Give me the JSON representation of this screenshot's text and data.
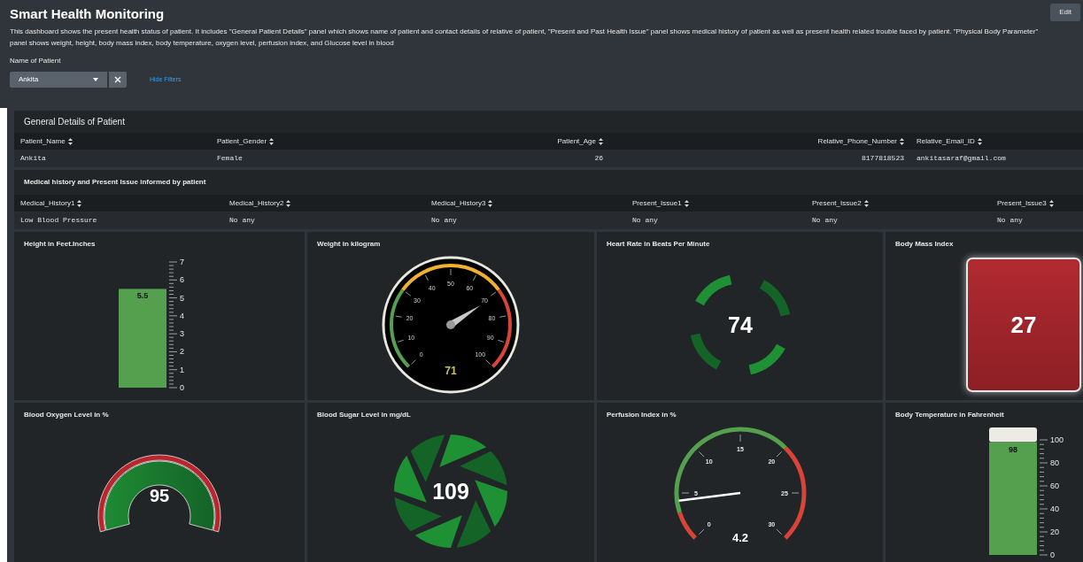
{
  "dashboard": {
    "title": "Smart Health Monitoring",
    "description": "This dashboard shows the present health status of patient. It includes \"General Patient Details\" panel which shows name of patient and contact details of relative of patient, \"Present and Past Health Issue\" panel shows medical history of patient as well as present health related trouble faced by patient. \"Physical Body Parameter\" panel shows weight, height, body mass index, body temperature, oxygen level, perfusion index, and Glucose level in blood",
    "edit_button": "Edit"
  },
  "filter": {
    "label": "Name of Patient",
    "value": "Ankita",
    "hide_filters": "Hide Filters"
  },
  "patient_table": {
    "title": "General Details of Patient",
    "columns": [
      "Patient_Name",
      "Patient_Gender",
      "Patient_Age",
      "Relative_Phone_Number",
      "Relative_Email_ID"
    ],
    "rows": [
      [
        "Ankita",
        "Female",
        "26",
        "8177818523",
        "ankitasaraf@gmail.com"
      ]
    ]
  },
  "history_table": {
    "title": "Medical history and Present Issue informed by patient",
    "columns": [
      "Medical_History1",
      "Medical_History2",
      "Medical_History3",
      "Present_Issue1",
      "Present_Issue2",
      "Present_Issue3"
    ],
    "rows": [
      [
        "Low Blood Pressure",
        "No any",
        "No any",
        "No any",
        "No any",
        "No any"
      ]
    ]
  },
  "panels": [
    {
      "kind": "filler",
      "title": "Height in Feet.Inches",
      "value": "5.5",
      "cap": false,
      "ticks": [
        "7",
        "6",
        "5",
        "4",
        "3",
        "2",
        "1",
        "0"
      ]
    },
    {
      "kind": "dial",
      "title": "Weight in kilogram",
      "value": "71",
      "ticks": [
        "0",
        "10",
        "20",
        "30",
        "40",
        "50",
        "60",
        "70",
        "80",
        "90",
        "100"
      ]
    },
    {
      "kind": "marker",
      "title": "Heart Rate in Beats Per Minute",
      "value": "74"
    },
    {
      "kind": "single",
      "title": "Body Mass Index",
      "value": "27"
    },
    {
      "kind": "semi",
      "title": "Blood Oxygen Level in %",
      "value": "95"
    },
    {
      "kind": "aperture",
      "title": "Blood Sugar Level in mg/dL",
      "value": "109"
    },
    {
      "kind": "arc_dial",
      "title": "Perfusion Index in %",
      "value": "4.2",
      "ticks": [
        "0",
        "5",
        "10",
        "15",
        "20",
        "25",
        "30"
      ]
    },
    {
      "kind": "filler",
      "title": "Body Temperature in Fahrenheit",
      "value": "98",
      "cap": true,
      "ticks": [
        "100",
        "80",
        "60",
        "40",
        "20",
        "0"
      ]
    }
  ]
}
